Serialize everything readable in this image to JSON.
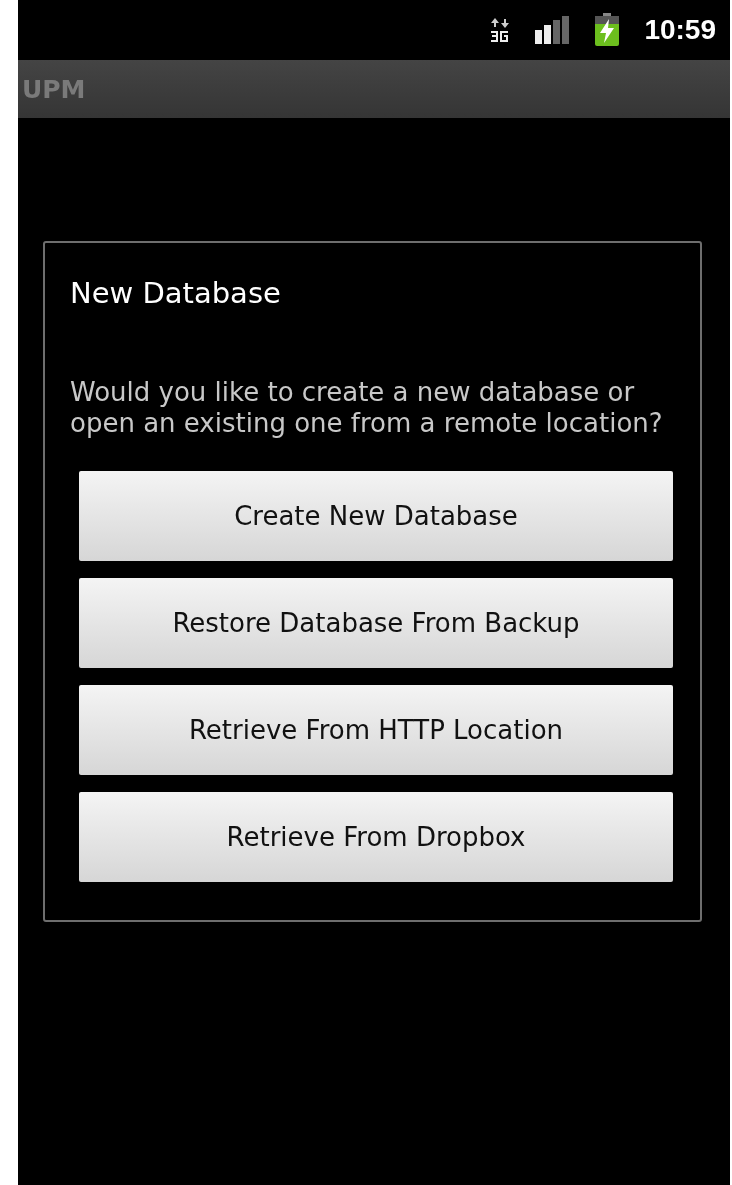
{
  "status_bar": {
    "time": "10:59"
  },
  "app_bar": {
    "title": "UPM"
  },
  "dialog": {
    "title": "New Database",
    "message": "Would you like to create a new database or open an existing one from a remote location?",
    "buttons": [
      {
        "label": "Create New Database"
      },
      {
        "label": "Restore Database From Backup"
      },
      {
        "label": "Retrieve From HTTP Location"
      },
      {
        "label": "Retrieve From Dropbox"
      }
    ]
  }
}
